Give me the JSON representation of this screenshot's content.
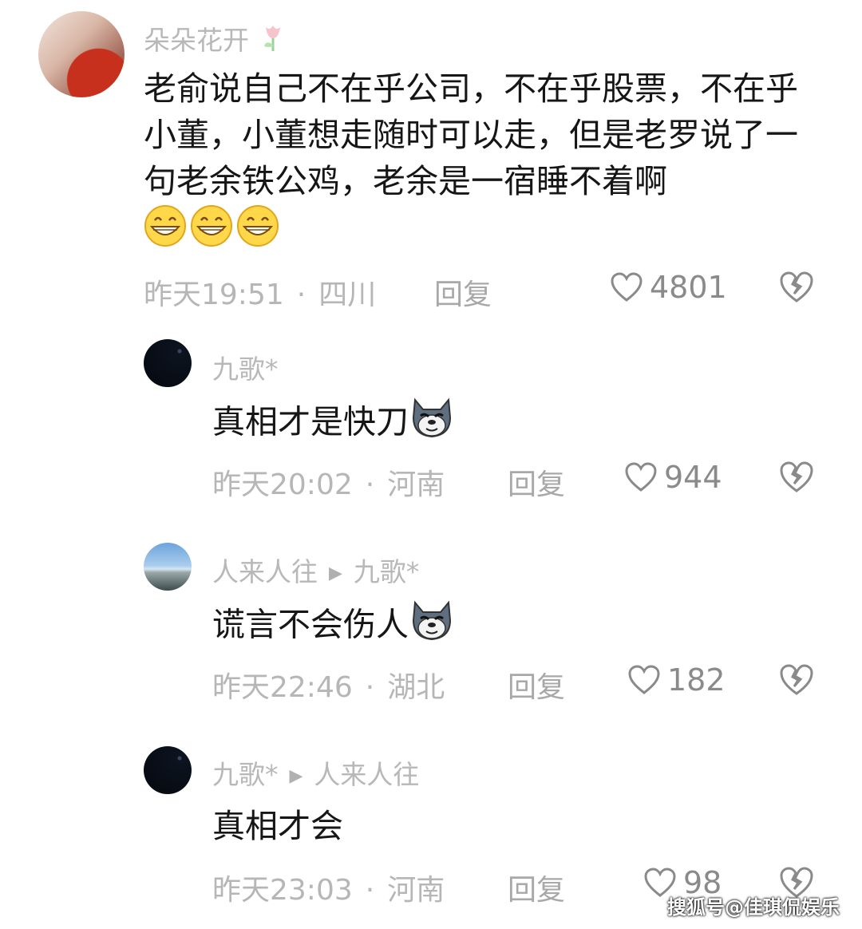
{
  "comments": [
    {
      "user": "朵朵花开",
      "user_icon": "tulip-icon",
      "text": "老俞说自己不在乎公司，不在乎股票，不在乎小董，小董想走随时可以走，但是老罗说了一句老余铁公鸡，老余是一宿睡不着啊",
      "emoji": "grin-emoji",
      "time": "昨天19:51",
      "location": "四川",
      "reply_label": "回复",
      "likes": "4801"
    },
    {
      "user": "九歌*",
      "text": "真相才是快刀",
      "emoji": "dog-emoji",
      "time": "昨天20:02",
      "location": "河南",
      "reply_label": "回复",
      "likes": "944"
    },
    {
      "user": "人来人往",
      "reply_to": "九歌*",
      "text": "谎言不会伤人",
      "emoji": "dog-emoji",
      "time": "昨天22:46",
      "location": "湖北",
      "reply_label": "回复",
      "likes": "182"
    },
    {
      "user": "九歌*",
      "reply_to": "人来人往",
      "text": "真相才会",
      "time": "昨天23:03",
      "location": "河南",
      "reply_label": "回复",
      "likes": "98"
    }
  ],
  "separator": "·",
  "watermark": "搜狐号@佳琪侃娱乐",
  "colors": {
    "text": "#161616",
    "meta": "#b6b6b6",
    "background": "#ffffff"
  }
}
